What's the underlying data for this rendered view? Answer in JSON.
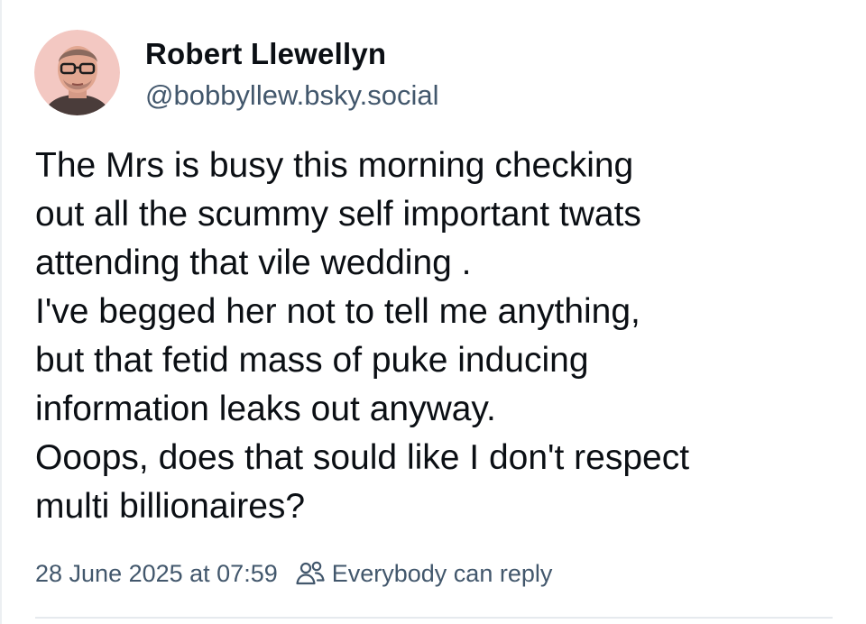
{
  "author": {
    "display_name": "Robert Llewellyn",
    "handle": "@bobbyllew.bsky.social",
    "avatar_icon": "avatar-photo"
  },
  "post": {
    "text": "The Mrs is busy this morning checking\nout all the scummy self important twats\nattending that vile wedding .\nI've begged her not to tell me anything,\nbut that fetid mass of puke inducing\ninformation leaks out anyway.\nOoops, does that sould like I don't respect\nmulti billionaires?"
  },
  "meta": {
    "timestamp": "28 June 2025 at 07:59",
    "reply_icon": "people-icon",
    "reply_setting": "Everybody can reply"
  },
  "colors": {
    "text": "#0b0f14",
    "muted": "#42576c",
    "divider": "#e6eaee"
  }
}
